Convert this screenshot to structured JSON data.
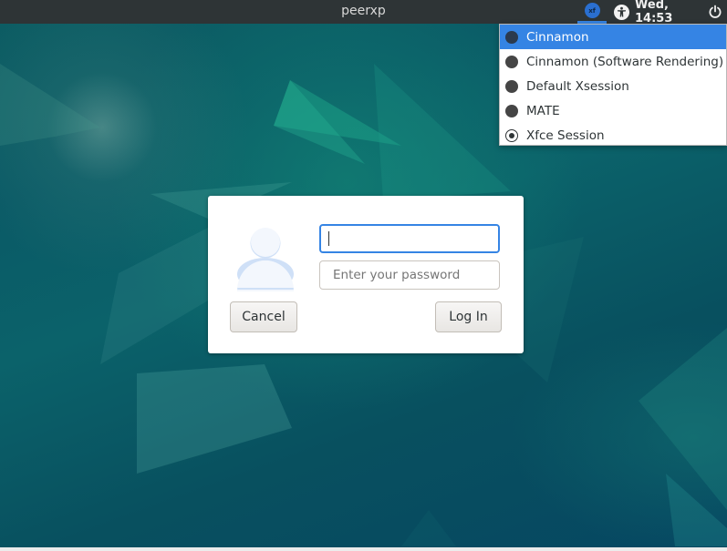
{
  "topbar": {
    "hostname": "peerxp",
    "session_indicator": {
      "icon": "xfce-session-icon",
      "label": "xf"
    },
    "accessibility_icon": "accessibility-icon",
    "clock": "Wed, 14:53",
    "power_icon": "power-icon"
  },
  "session_menu": {
    "items": [
      {
        "label": "Cinnamon",
        "highlighted": true,
        "selected": false
      },
      {
        "label": "Cinnamon (Software Rendering)",
        "highlighted": false,
        "selected": false
      },
      {
        "label": "Default Xsession",
        "highlighted": false,
        "selected": false
      },
      {
        "label": "MATE",
        "highlighted": false,
        "selected": false
      },
      {
        "label": "Xfce Session",
        "highlighted": false,
        "selected": true
      }
    ]
  },
  "login": {
    "avatar_icon": "user-avatar-icon",
    "username_value": "",
    "password_placeholder": "Enter your password",
    "cancel_label": "Cancel",
    "login_label": "Log In"
  },
  "colors": {
    "accent": "#3584e4",
    "topbar": "#2e3436",
    "desktop": "#0b5a64"
  }
}
